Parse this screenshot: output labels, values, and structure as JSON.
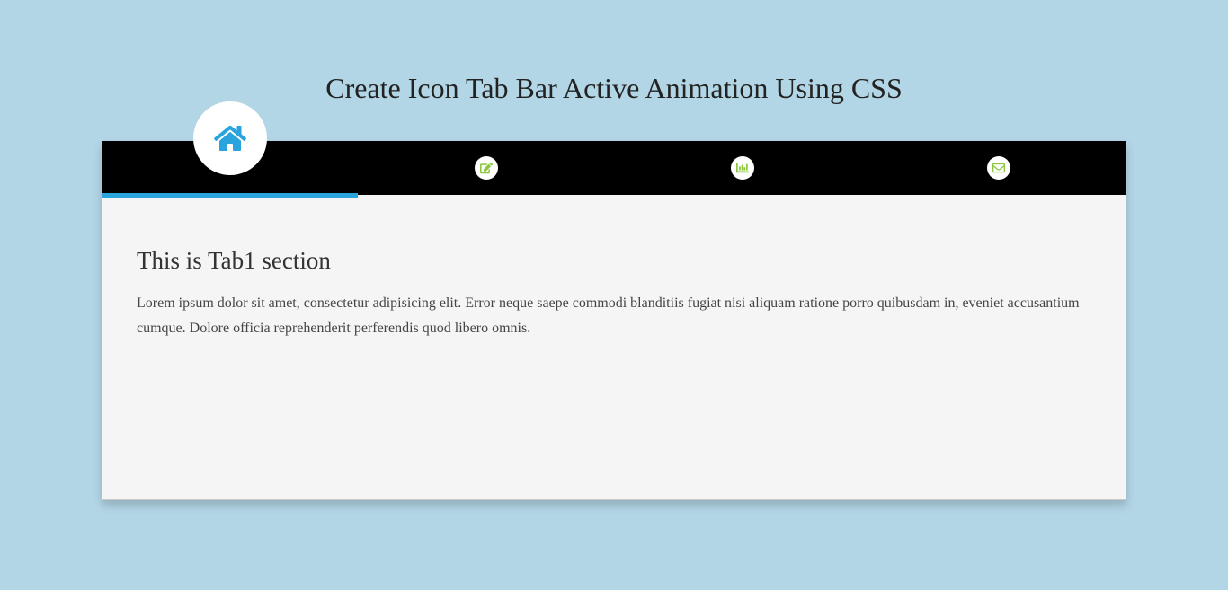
{
  "page": {
    "title": "Create Icon Tab Bar Active Animation Using CSS"
  },
  "tabs": [
    {
      "icon": "home-icon",
      "active": true
    },
    {
      "icon": "edit-icon",
      "active": false
    },
    {
      "icon": "chart-icon",
      "active": false
    },
    {
      "icon": "envelope-icon",
      "active": false
    }
  ],
  "content": {
    "heading": "This is Tab1 section",
    "body": "Lorem ipsum dolor sit amet, consectetur adipisicing elit. Error neque saepe commodi blanditiis fugiat nisi aliquam ratione porro quibusdam in, eveniet accusantium cumque. Dolore officia reprehenderit perferendis quod libero omnis."
  },
  "colors": {
    "background": "#b3d6e6",
    "tabbar": "#000000",
    "accent": "#29a4dc",
    "inactive_icon": "#8cc63f",
    "panel": "#f5f5f5"
  }
}
